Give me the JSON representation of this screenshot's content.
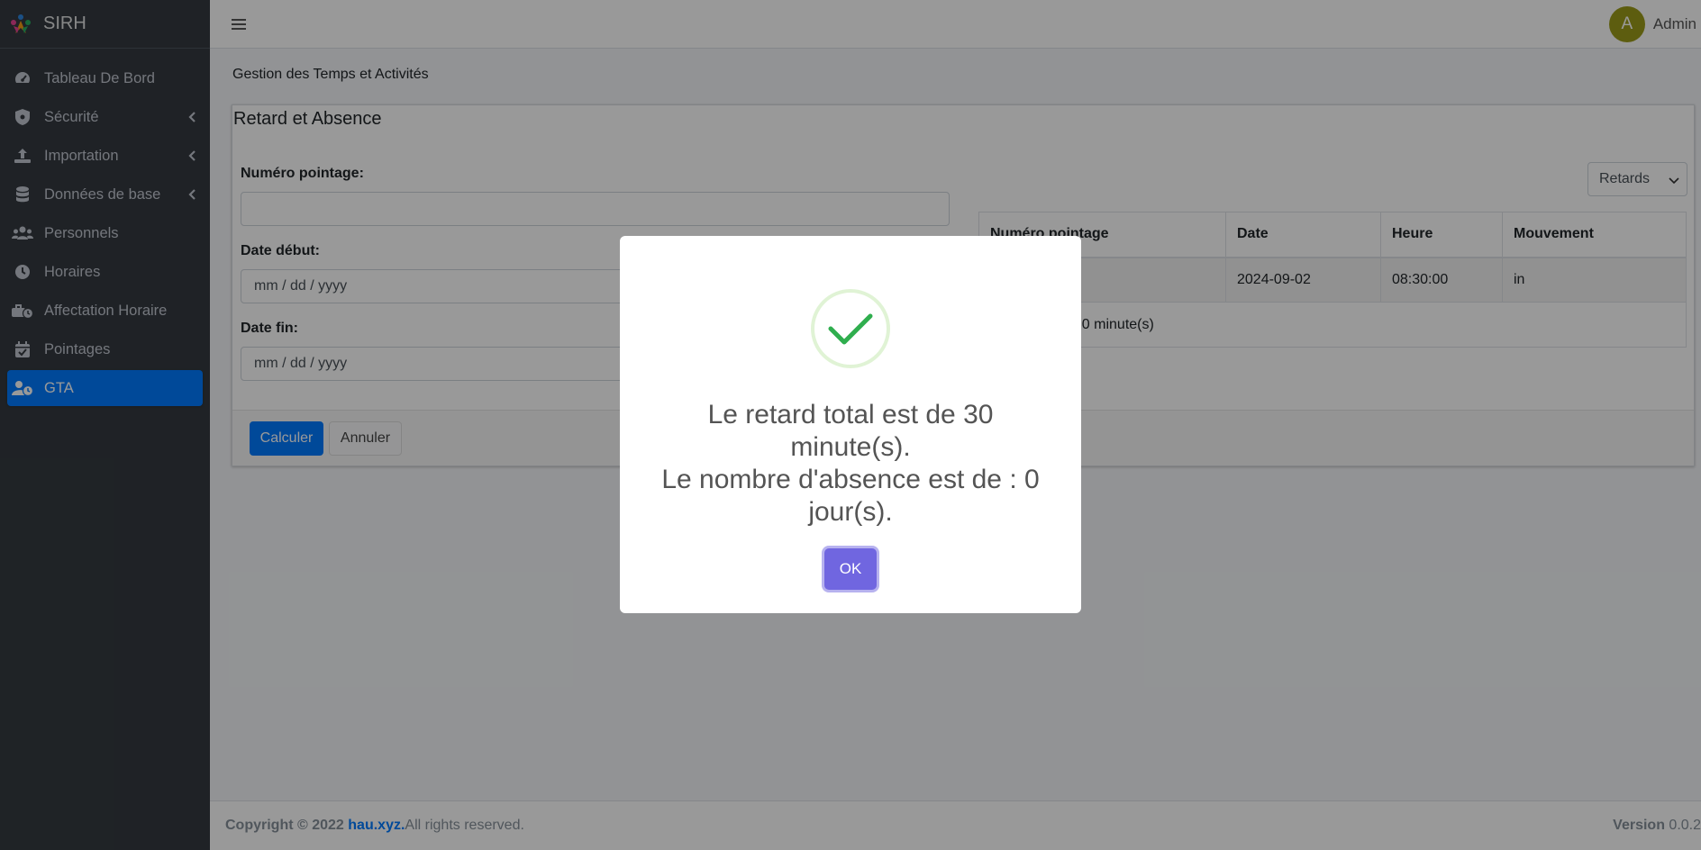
{
  "app": {
    "brand": "SIRH"
  },
  "sidebar": {
    "items": [
      {
        "label": "Tableau De Bord",
        "icon": "tachometer-icon"
      },
      {
        "label": "Sécurité",
        "icon": "shield-icon"
      },
      {
        "label": "Importation",
        "icon": "upload-icon"
      },
      {
        "label": "Données de base",
        "icon": "database-icon"
      },
      {
        "label": "Personnels",
        "icon": "users-icon"
      },
      {
        "label": "Horaires",
        "icon": "clock-icon"
      },
      {
        "label": "Affectation Horaire",
        "icon": "user-clock-icon"
      },
      {
        "label": "Pointages",
        "icon": "calendar-check-icon"
      },
      {
        "label": "GTA",
        "icon": "user-clock-icon"
      }
    ],
    "active": "GTA"
  },
  "topbar": {
    "user_initial": "A",
    "user_name": "Admin"
  },
  "page": {
    "title": "Gestion des Temps et Activités",
    "card_title": "Retard et Absence",
    "form": {
      "numero_label": "Numéro pointage:",
      "numero_value": "",
      "date_debut_label": "Date début:",
      "date_debut_placeholder": "mm / dd / yyyy",
      "date_fin_label": "Date fin:",
      "date_fin_placeholder": "mm / dd / yyyy",
      "calculer_label": "Calculer",
      "annuler_label": "Annuler"
    },
    "filter_select": {
      "selected": "Retards"
    },
    "table": {
      "headers": [
        "Numéro pointage",
        "Date",
        "Heure",
        "Mouvement"
      ],
      "rows": [
        {
          "numero": "",
          "date": "2024-09-02",
          "heure": "08:30:00",
          "mouvement": "in"
        }
      ],
      "summary_visible": ": 30 minute(s)"
    }
  },
  "footer": {
    "copyright_prefix": "Copyright © 2022 ",
    "link": "hau.xyz.",
    "rights": " All rights reserved.",
    "version_label": "Version",
    "version_value": " 0.0.2"
  },
  "modal": {
    "line1": "Le retard total est de 30 minute(s).",
    "line2": "Le nombre d'absence est de : 0 jour(s).",
    "ok_label": "OK"
  },
  "colors": {
    "sidebar_bg": "#343a40",
    "active": "#007bff",
    "ok_button": "#7066e0",
    "success": "#28a745",
    "avatar": "#9c9c1a"
  }
}
